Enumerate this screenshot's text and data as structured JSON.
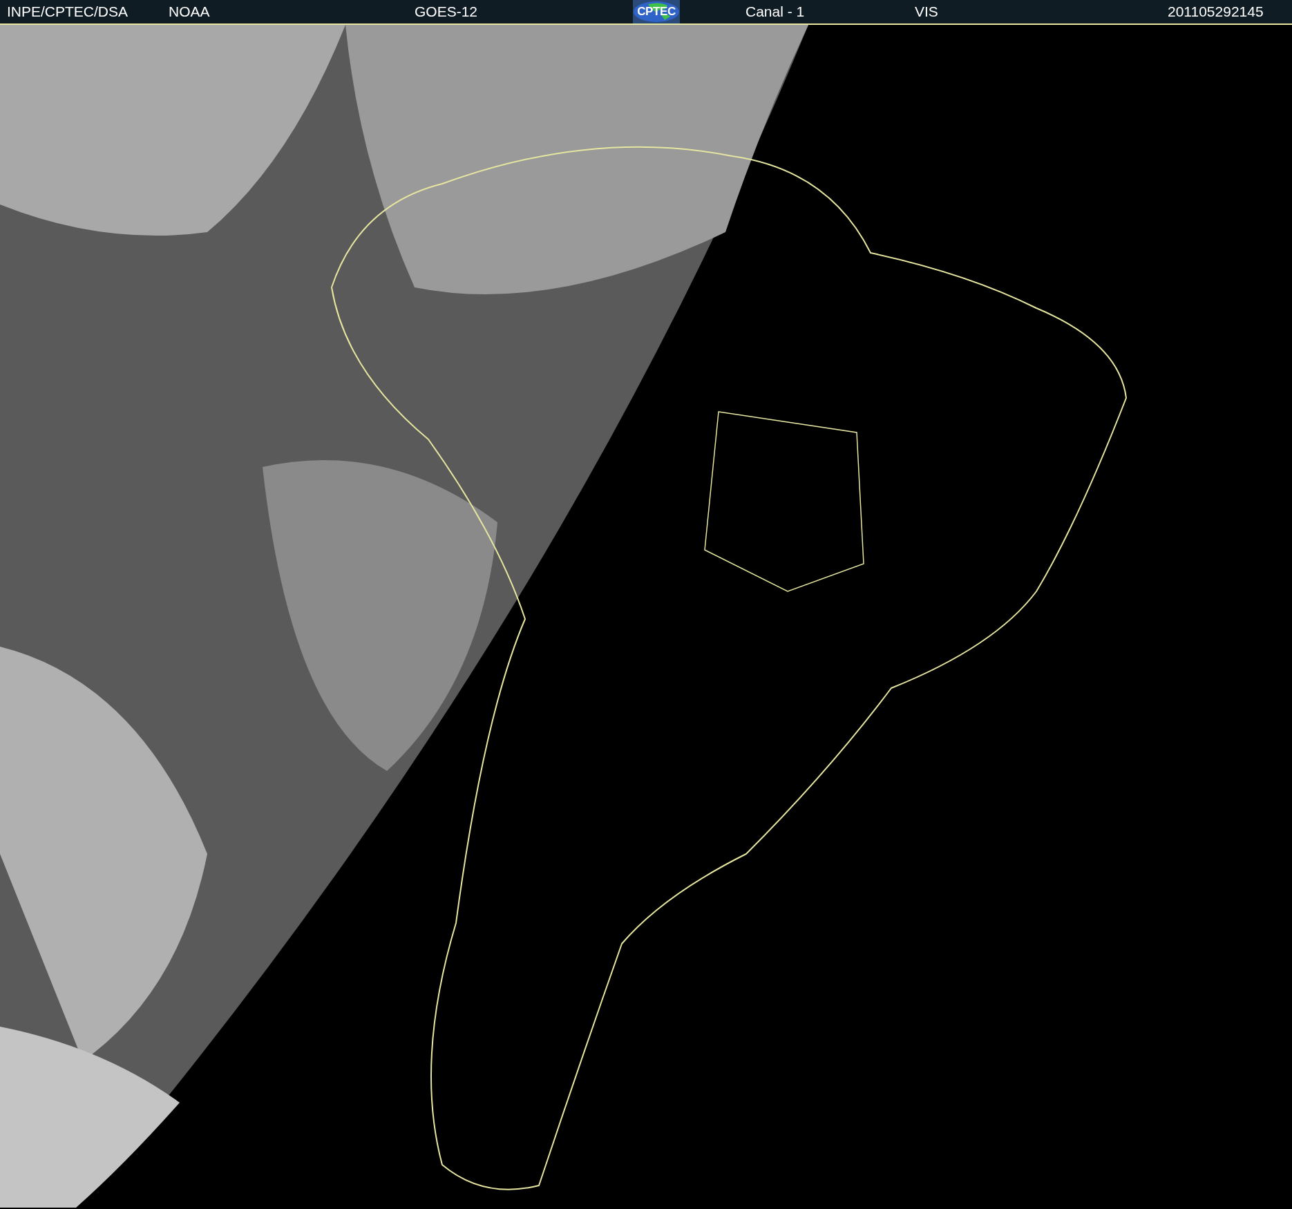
{
  "header": {
    "items": [
      {
        "kind": "text",
        "text": "INPE/CPTEC/DSA"
      },
      {
        "kind": "text",
        "text": "NOAA"
      },
      {
        "kind": "text",
        "text": "GOES-12"
      },
      {
        "kind": "logo",
        "text": "CPTEC"
      },
      {
        "kind": "text",
        "text": "Canal - 1"
      },
      {
        "kind": "text",
        "text": "VIS"
      },
      {
        "kind": "text",
        "text": "201105292145"
      }
    ]
  }
}
